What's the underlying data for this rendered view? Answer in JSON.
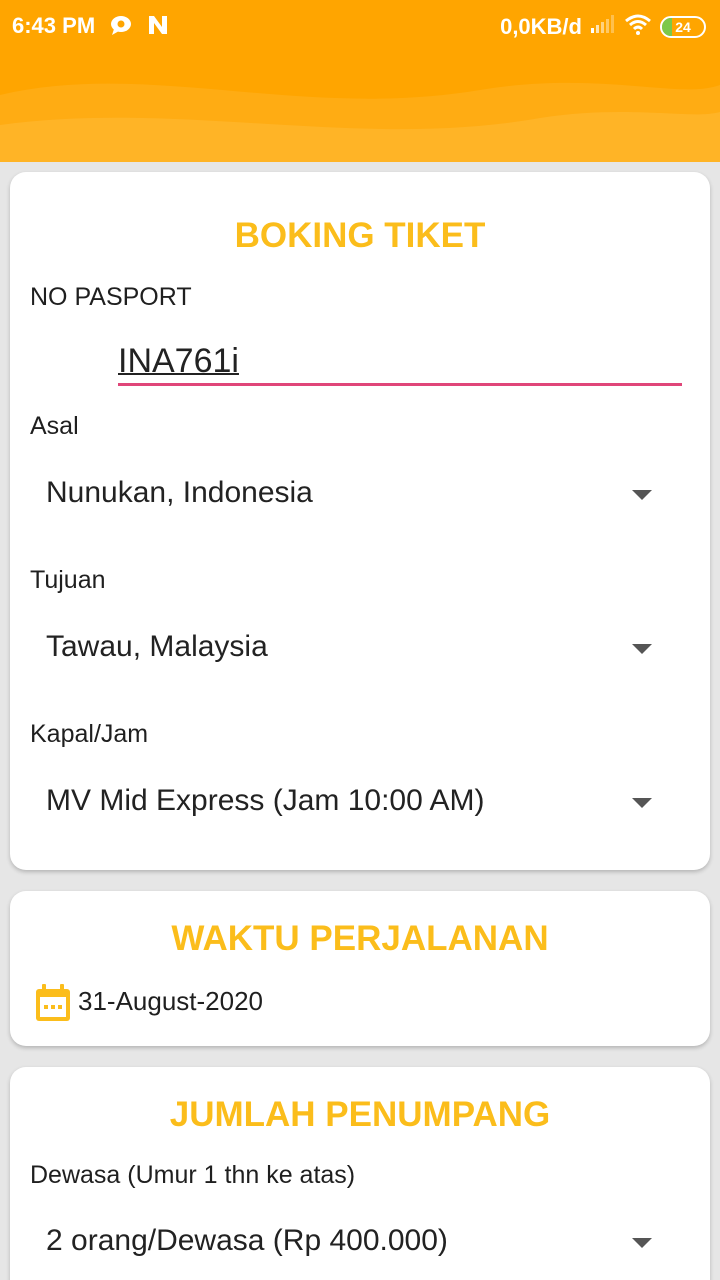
{
  "status_bar": {
    "time": "6:43 PM",
    "network_speed": "0,0KB/d",
    "battery_level": "24",
    "icons": [
      "chat-bubble-icon",
      "n-notification-icon",
      "signal-icon",
      "wifi-icon",
      "battery-icon"
    ]
  },
  "colors": {
    "header": "#ffa500",
    "title": "#fbbd1b",
    "input_underline": "#e04679",
    "card_bg": "#ffffff",
    "page_bg": "#e6e6e6"
  },
  "booking": {
    "title": "BOKING TIKET",
    "passport_label": "NO PASPORT",
    "passport_value": "INA761i",
    "origin_label": "Asal",
    "origin_value": "Nunukan, Indonesia",
    "destination_label": "Tujuan",
    "destination_value": "Tawau, Malaysia",
    "ship_label": "Kapal/Jam",
    "ship_value": "MV Mid Express (Jam 10:00 AM)"
  },
  "travel_time": {
    "title": "WAKTU PERJALANAN",
    "date": "31-August-2020",
    "icon": "calendar-icon"
  },
  "passengers": {
    "title": "JUMLAH PENUMPANG",
    "adult_label": "Dewasa (Umur 1 thn ke atas)",
    "adult_value": "2 orang/Dewasa (Rp 400.000)"
  }
}
